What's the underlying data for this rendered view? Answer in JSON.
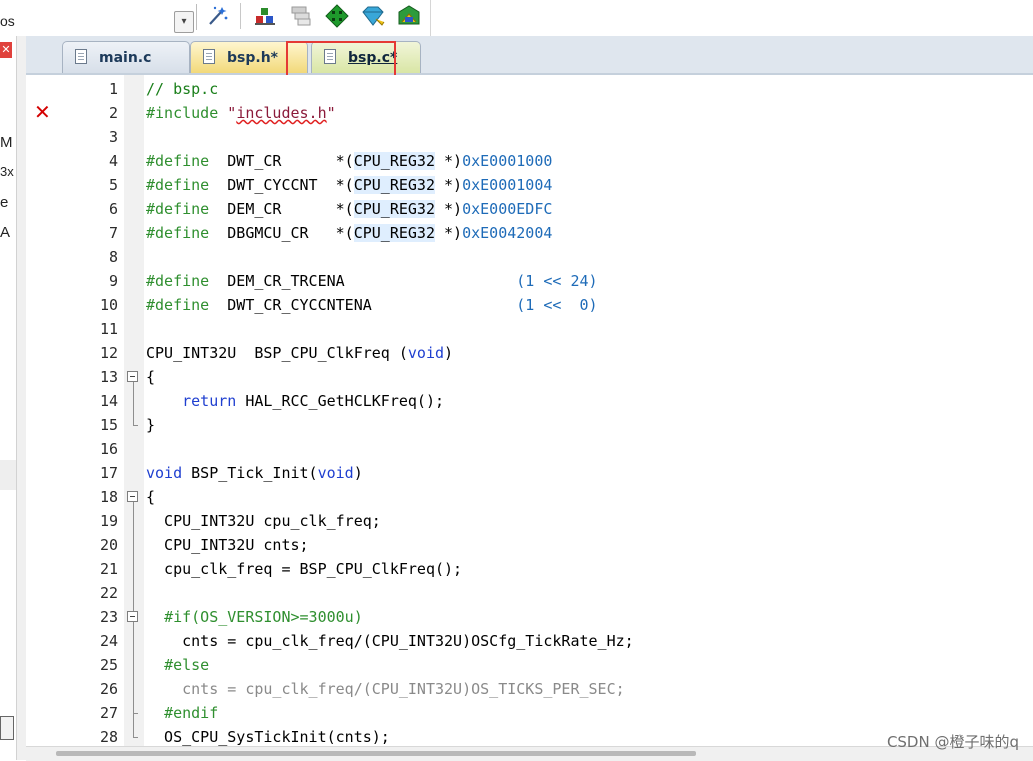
{
  "toolbar": {
    "target_text": "os",
    "buttons": [
      {
        "name": "magic-wand-icon"
      },
      {
        "name": "load-icon"
      },
      {
        "name": "stack-icon"
      },
      {
        "name": "green-diamond-icon"
      },
      {
        "name": "blue-gem-icon"
      },
      {
        "name": "debug-icon"
      }
    ]
  },
  "left_panel": {
    "fragments": [
      "M",
      "3x",
      "e",
      "A"
    ]
  },
  "tabs": [
    {
      "label": "main.c",
      "active": false
    },
    {
      "label": "bsp.h*",
      "active": false
    },
    {
      "label": "bsp.c*",
      "active": true
    }
  ],
  "editor": {
    "error_line": 2,
    "error_marker": "✕",
    "lines": [
      {
        "n": "1",
        "text": "// bsp.c"
      },
      {
        "n": "2",
        "text": "#include \"includes.h\""
      },
      {
        "n": "3",
        "text": ""
      },
      {
        "n": "4",
        "text": "#define  DWT_CR      *(CPU_REG32 *)0xE0001000"
      },
      {
        "n": "5",
        "text": "#define  DWT_CYCCNT  *(CPU_REG32 *)0xE0001004"
      },
      {
        "n": "6",
        "text": "#define  DEM_CR      *(CPU_REG32 *)0xE000EDFC"
      },
      {
        "n": "7",
        "text": "#define  DBGMCU_CR   *(CPU_REG32 *)0xE0042004"
      },
      {
        "n": "8",
        "text": ""
      },
      {
        "n": "9",
        "text": "#define  DEM_CR_TRCENA                   (1 << 24)"
      },
      {
        "n": "10",
        "text": "#define  DWT_CR_CYCCNTENA                (1 <<  0)"
      },
      {
        "n": "11",
        "text": ""
      },
      {
        "n": "12",
        "text": "CPU_INT32U  BSP_CPU_ClkFreq (void)"
      },
      {
        "n": "13",
        "text": "{"
      },
      {
        "n": "14",
        "text": "    return HAL_RCC_GetHCLKFreq();"
      },
      {
        "n": "15",
        "text": "}"
      },
      {
        "n": "16",
        "text": ""
      },
      {
        "n": "17",
        "text": "void BSP_Tick_Init(void)"
      },
      {
        "n": "18",
        "text": "{"
      },
      {
        "n": "19",
        "text": "  CPU_INT32U cpu_clk_freq;"
      },
      {
        "n": "20",
        "text": "  CPU_INT32U cnts;"
      },
      {
        "n": "21",
        "text": "  cpu_clk_freq = BSP_CPU_ClkFreq();"
      },
      {
        "n": "22",
        "text": ""
      },
      {
        "n": "23",
        "text": "  #if(OS_VERSION>=3000u)"
      },
      {
        "n": "24",
        "text": "    cnts = cpu_clk_freq/(CPU_INT32U)OSCfg_TickRate_Hz;"
      },
      {
        "n": "25",
        "text": "  #else"
      },
      {
        "n": "26",
        "text": "    cnts = cpu_clk_freq/(CPU_INT32U)OS_TICKS_PER_SEC;"
      },
      {
        "n": "27",
        "text": "  #endif"
      },
      {
        "n": "28",
        "text": "  OS_CPU_SysTickInit(cnts);"
      }
    ]
  },
  "watermark": "CSDN @橙子味的q"
}
